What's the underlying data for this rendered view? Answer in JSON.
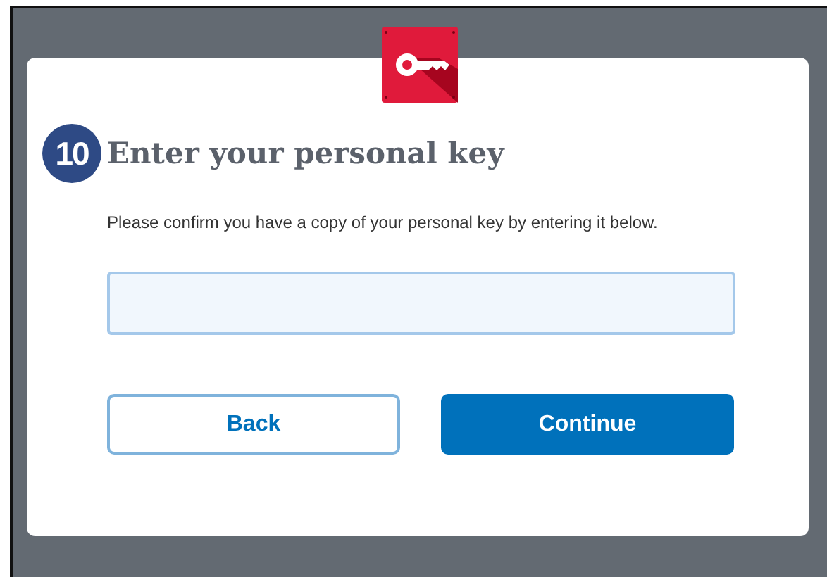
{
  "step": {
    "number": "10",
    "title": "Enter your personal key"
  },
  "instructions": "Please confirm you have a copy of your personal key by entering it below.",
  "key_field": {
    "focused": true
  },
  "buttons": [
    {
      "label": "Back",
      "kind": "secondary"
    },
    {
      "label": "Continue",
      "kind": "primary"
    }
  ]
}
